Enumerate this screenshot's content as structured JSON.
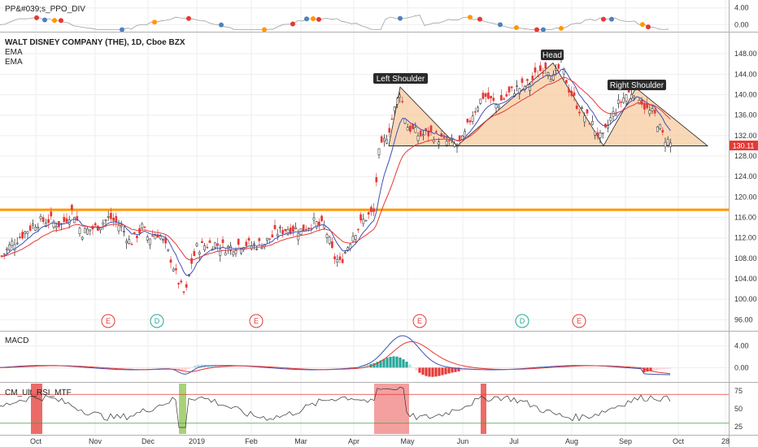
{
  "panels": {
    "ppo": {
      "title": "PP&#039;s_PPO_DIV",
      "ticks": [
        "4.00",
        "0.00"
      ]
    },
    "price": {
      "title": "WALT DISNEY COMPANY (THE), 1D, Cboe BZX",
      "legend": [
        "EMA",
        "EMA"
      ],
      "ticks": [
        "148.00",
        "144.00",
        "140.00",
        "136.00",
        "132.00",
        "128.00",
        "124.00",
        "120.00",
        "116.00",
        "112.00",
        "108.00",
        "104.00",
        "100.00",
        "96.00"
      ],
      "last_price": "130.11",
      "annotations": [
        {
          "label": "Left Shoulder"
        },
        {
          "label": "Head"
        },
        {
          "label": "Right Shoulder"
        }
      ],
      "events": [
        {
          "kind": "E",
          "color": "#e53935"
        },
        {
          "kind": "D",
          "color": "#26a69a"
        },
        {
          "kind": "E",
          "color": "#e53935"
        },
        {
          "kind": "E",
          "color": "#e53935"
        },
        {
          "kind": "D",
          "color": "#26a69a"
        },
        {
          "kind": "E",
          "color": "#e53935"
        }
      ]
    },
    "macd": {
      "title": "MACD",
      "ticks": [
        "4.00",
        "0.00"
      ]
    },
    "rsi": {
      "title": "CM_Ult_RSI_MTF",
      "ticks": [
        "75",
        "50",
        "25"
      ]
    }
  },
  "xaxis": [
    "Oct",
    "Nov",
    "Dec",
    "2019",
    "Feb",
    "Mar",
    "Apr",
    "May",
    "Jun",
    "Jul",
    "Aug",
    "Sep",
    "Oct",
    "28"
  ],
  "colors": {
    "up": "#26a69a",
    "down": "#e53935",
    "ema_fast": "#3f51b5",
    "ema_slow": "#e53935",
    "resistance": "#ff9800",
    "pattern_fill": "#f7ceA3"
  },
  "chart_data": [
    {
      "type": "line",
      "title": "WALT DISNEY COMPANY (THE), 1D, Cboe BZX",
      "xlabel": "",
      "ylabel": "",
      "x": [
        "Sep",
        "Oct",
        "Nov",
        "Dec",
        "Jan",
        "Feb",
        "Mar",
        "Apr",
        "May",
        "Jun",
        "Jul",
        "Aug",
        "Sep",
        "Oct"
      ],
      "series": [
        {
          "name": "",
          "values": [
            108,
            115,
            115.5,
            112,
            101,
            111,
            113,
            108,
            141,
            130,
            146,
            131,
            141,
            130.11
          ]
        }
      ],
      "ylim": [
        94,
        152
      ],
      "resistance_level": 117.5,
      "pattern": "head and shoulders",
      "neckline": 130
    },
    {
      "type": "line",
      "title": "PP&#039;s_PPO_DIV",
      "ylim": [
        -1.5,
        5.5
      ]
    },
    {
      "type": "bar",
      "title": "MACD",
      "ylim": [
        -2.5,
        6.5
      ]
    },
    {
      "type": "line",
      "title": "CM_Ult_RSI_MTF",
      "ylim": [
        15,
        85
      ],
      "upper": 70,
      "lower": 30
    }
  ]
}
